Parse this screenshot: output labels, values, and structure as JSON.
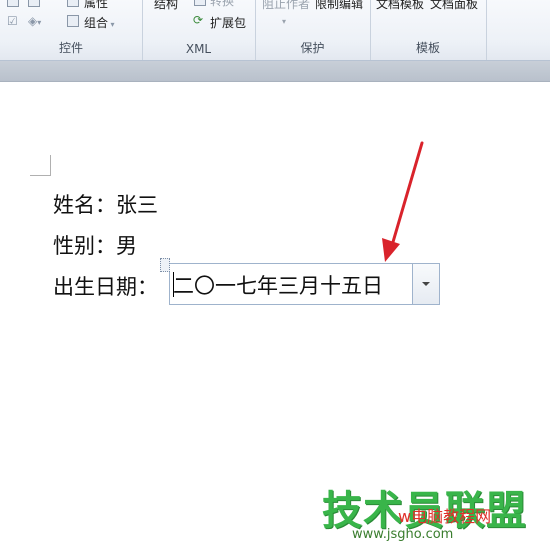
{
  "ribbon": {
    "controls_group": {
      "label": "控件",
      "items": [
        "属性",
        "组合"
      ]
    },
    "xml_group": {
      "label": "XML",
      "items": [
        "结构",
        "扩展包"
      ]
    },
    "protect_group": {
      "label": "保护",
      "items": [
        "阻止作者",
        "限制编辑"
      ]
    },
    "template_group": {
      "label": "模板",
      "items": [
        "文档模板",
        "文档面板"
      ]
    }
  },
  "document": {
    "name_line": "姓名：张三",
    "gender_line": "性别：男",
    "birth_label": "出生日期：",
    "birth_value": "二〇一七年三月十五日"
  },
  "watermark": {
    "big": "技术员联盟",
    "red": "w电脑教程网",
    "url": "www.jsgho.com"
  },
  "colors": {
    "arrow": "#d9232b",
    "watermark_green": "#39b54a"
  }
}
